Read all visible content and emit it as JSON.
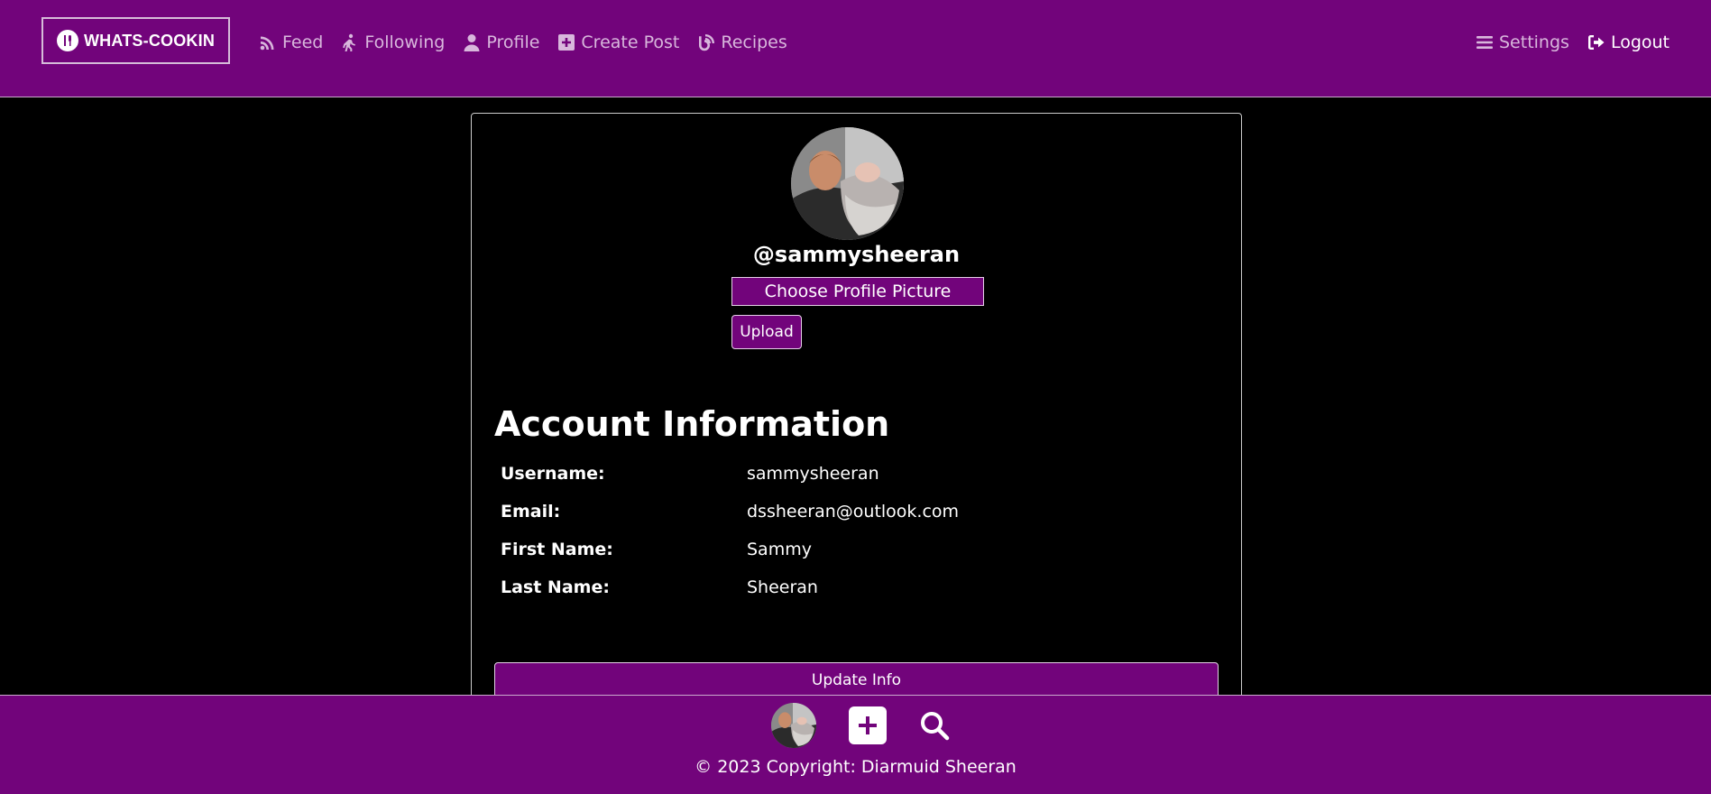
{
  "brand": {
    "name": "WHATS-COOKIN"
  },
  "nav": {
    "links": [
      {
        "label": "Feed",
        "icon": "rss-icon"
      },
      {
        "label": "Following",
        "icon": "walking-icon"
      },
      {
        "label": "Profile",
        "icon": "user-icon"
      },
      {
        "label": "Create Post",
        "icon": "plus-square-icon"
      },
      {
        "label": "Recipes",
        "icon": "blog-icon"
      }
    ],
    "settings_label": "Settings",
    "logout_label": "Logout"
  },
  "profile": {
    "handle": "@sammysheeran",
    "choose_picture_label": "Choose Profile Picture",
    "upload_label": "Upload"
  },
  "account": {
    "title": "Account Information",
    "rows": [
      {
        "label": "Username:",
        "value": "sammysheeran"
      },
      {
        "label": "Email:",
        "value": "dssheeran@outlook.com"
      },
      {
        "label": "First Name:",
        "value": "Sammy"
      },
      {
        "label": "Last Name:",
        "value": "Sheeran"
      }
    ],
    "update_label": "Update Info"
  },
  "footer": {
    "copyright": "© 2023 Copyright: Diarmuid Sheeran"
  },
  "colors": {
    "brand_purple": "#72047b",
    "background": "#000000",
    "muted_link": "#d8b7dc"
  }
}
